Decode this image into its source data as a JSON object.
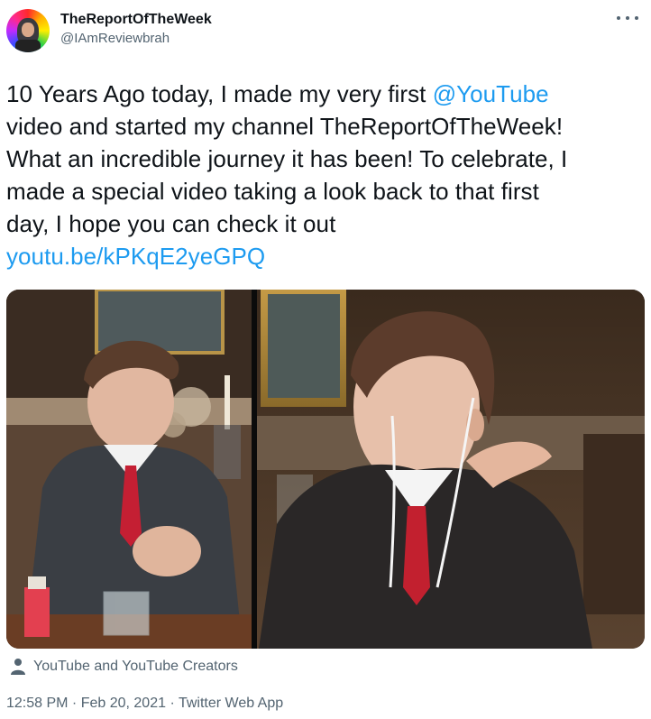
{
  "user": {
    "display_name": "TheReportOfTheWeek",
    "handle": "@IAmReviewbrah"
  },
  "tweet": {
    "line1_pre": "10 Years Ago today, I made my very first ",
    "mention": "@YouTube",
    "line2": "video and started my channel TheReportOfTheWeek!",
    "line3": "What an incredible journey it has been! To celebrate, I",
    "line4": "made a special video taking a look back to that first",
    "line5": "day, I hope you can check it out",
    "link": "youtu.be/kPKqE2yeGPQ"
  },
  "media": {
    "attribution": "YouTube and YouTube Creators"
  },
  "meta": {
    "time": "12:58 PM",
    "sep1": " · ",
    "date": "Feb 20, 2021",
    "sep2": " · ",
    "source": "Twitter Web App"
  },
  "colors": {
    "link": "#1d9bf0",
    "secondary_text": "#536471",
    "primary_text": "#0f1419"
  }
}
